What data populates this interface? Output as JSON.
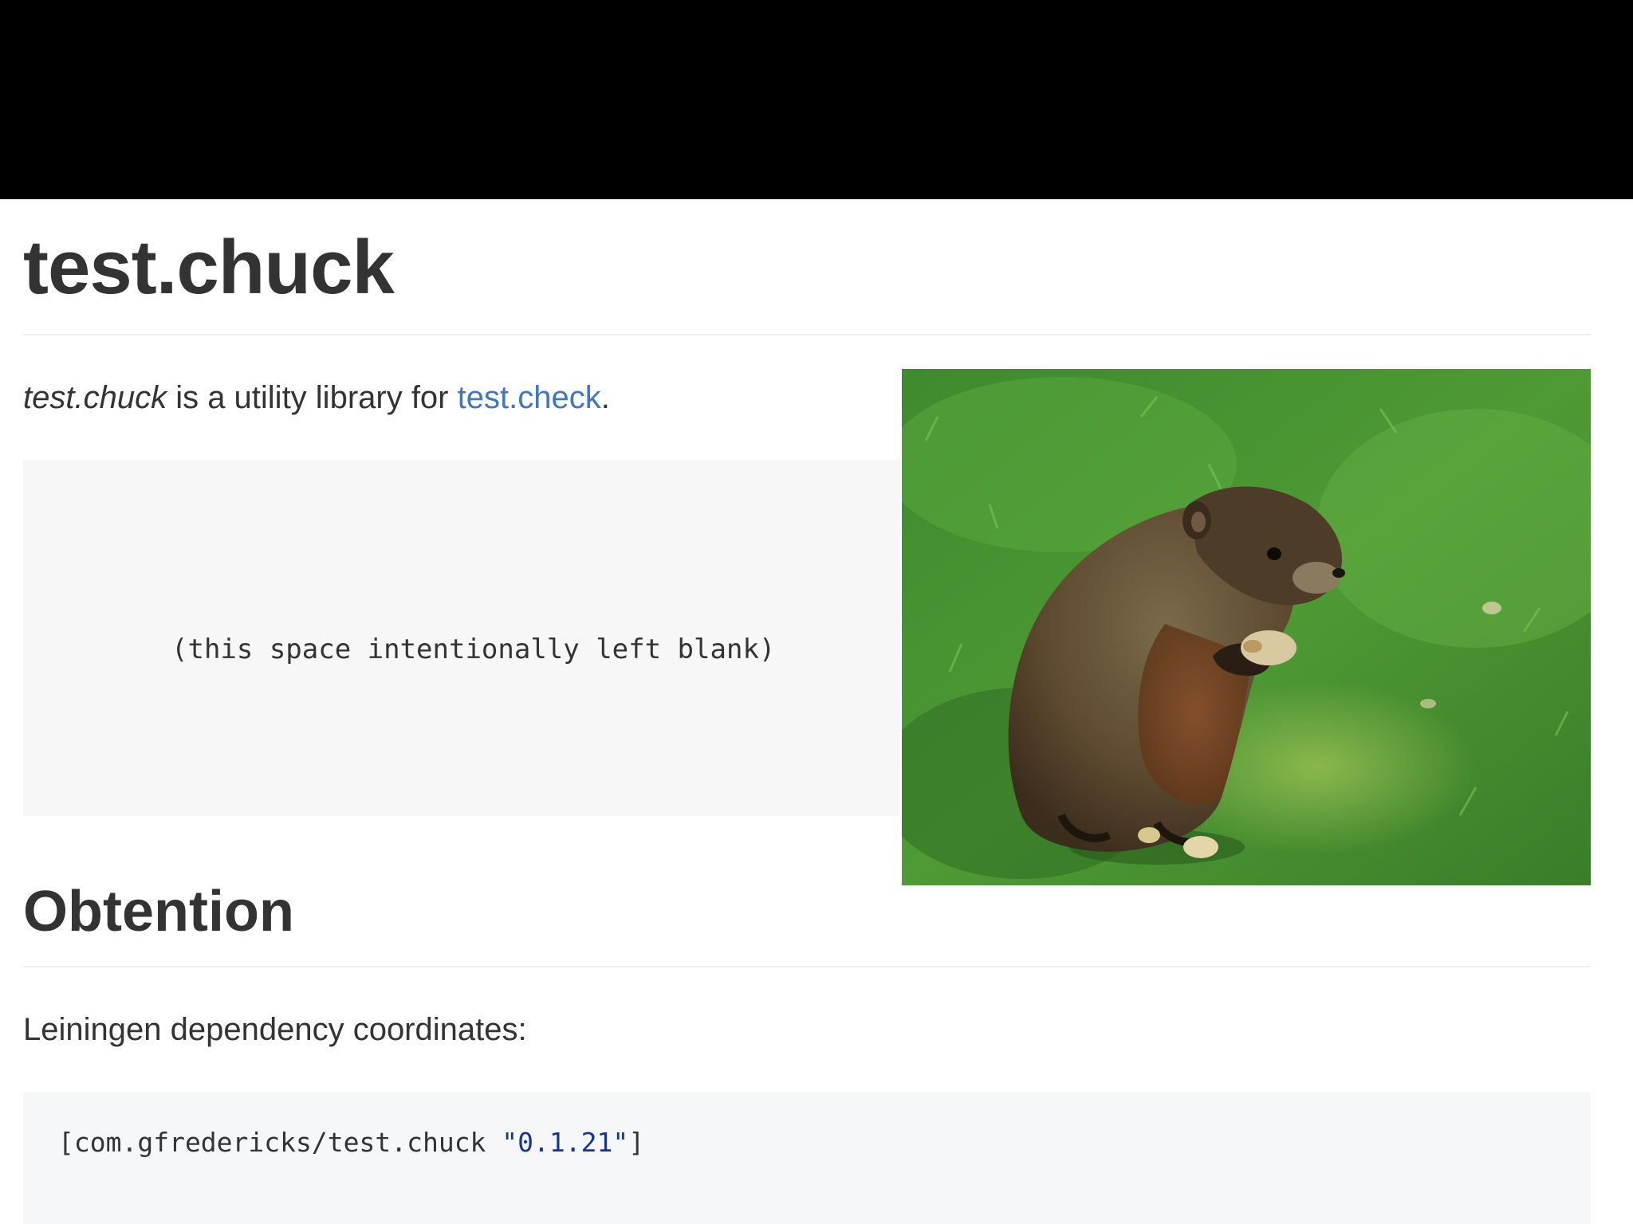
{
  "header": {
    "title": "test.chuck"
  },
  "intro": {
    "emphasis": "test.chuck",
    "middle": " is a utility library for ",
    "link_text": "test.check",
    "end": "."
  },
  "blank_block": {
    "text": "(this space intentionally left blank)"
  },
  "photo": {
    "description_icon": "groundhog-photo"
  },
  "obtention": {
    "heading": "Obtention",
    "lead": "Leiningen dependency coordinates:",
    "code_prefix": "[com.gfredericks/test.chuck ",
    "code_string": "\"0.1.21\"",
    "code_suffix": "]"
  },
  "colors": {
    "link": "#4078c0",
    "code_string": "#183691",
    "code_bg": "#f6f7f8",
    "blank_bg": "#f7f7f7"
  }
}
